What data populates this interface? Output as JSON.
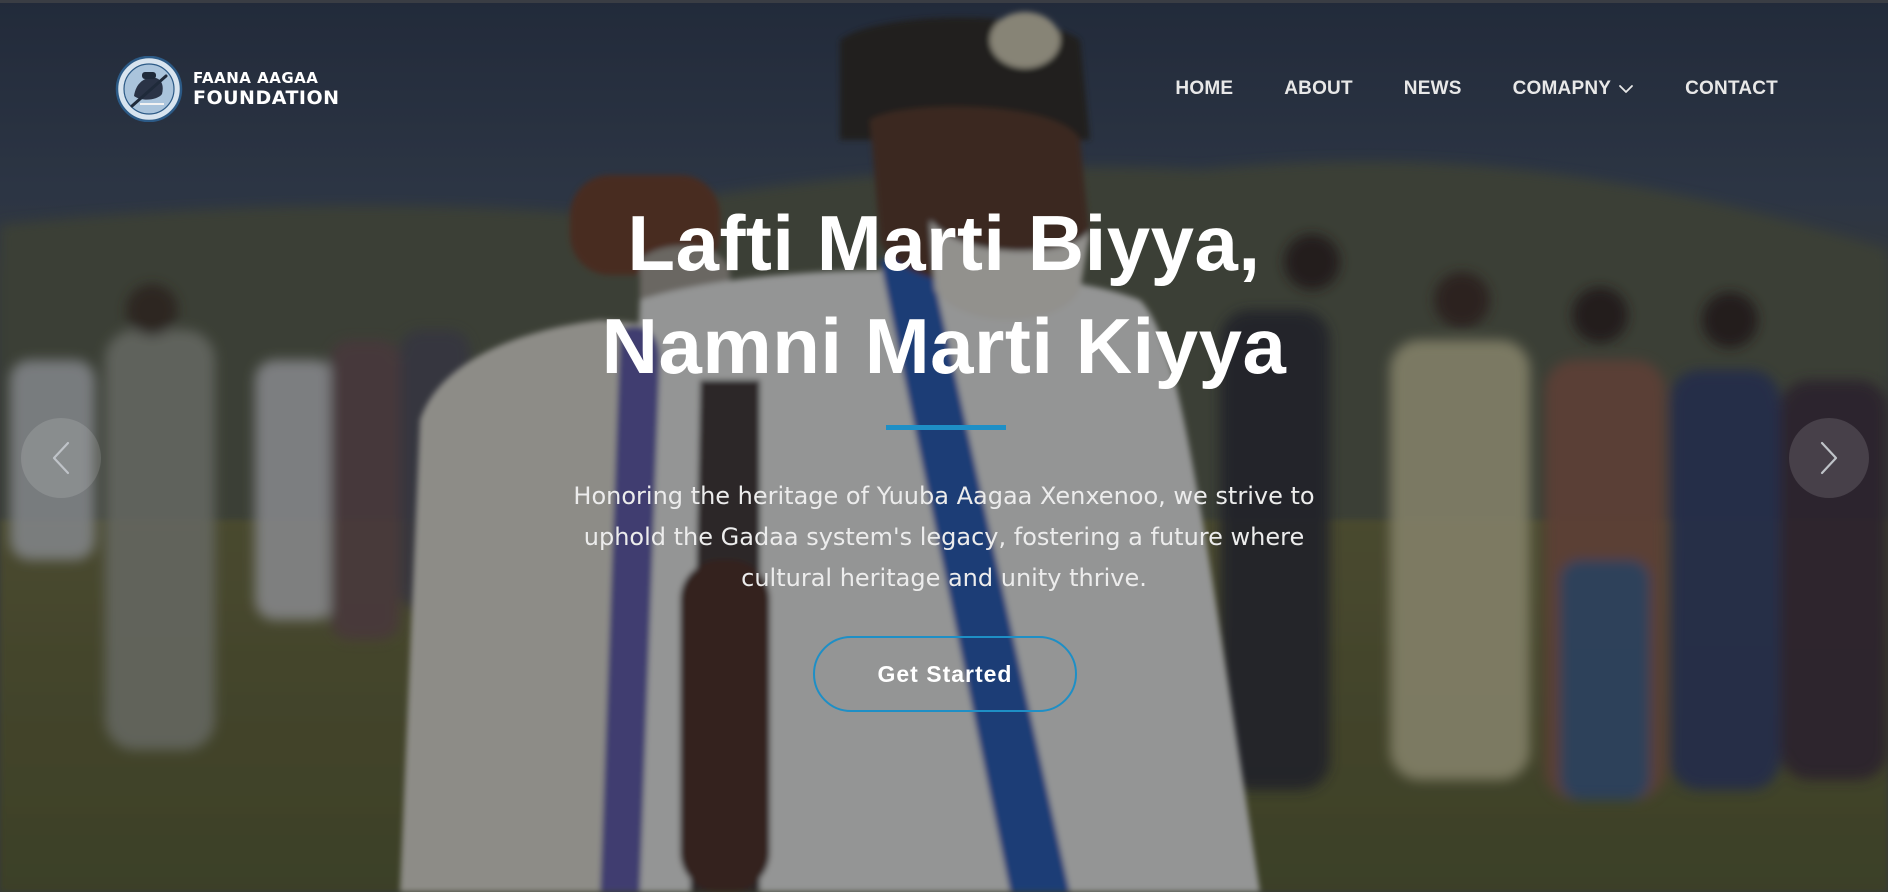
{
  "brand": {
    "line1": "FAANA AAGAA",
    "line2": "FOUNDATION"
  },
  "nav": {
    "items": [
      {
        "label": "HOME"
      },
      {
        "label": "ABOUT"
      },
      {
        "label": "NEWS"
      },
      {
        "label": "COMAPNY",
        "has_dropdown": true,
        "icon": "chevron-down-icon"
      },
      {
        "label": "CONTACT"
      }
    ]
  },
  "hero": {
    "headline_line1": "Lafti Marti Biyya,",
    "headline_line2": "Namni Marti Kiyya",
    "description": "Honoring the heritage of Yuuba Aagaa Xenxenoo, we strive to uphold the Gadaa system's legacy, fostering a future where cultural heritage and unity thrive.",
    "cta_label": "Get Started",
    "prev_icon": "chevron-left-icon",
    "next_icon": "chevron-right-icon"
  },
  "colors": {
    "accent": "#1e8fc6",
    "text": "#ffffff"
  }
}
